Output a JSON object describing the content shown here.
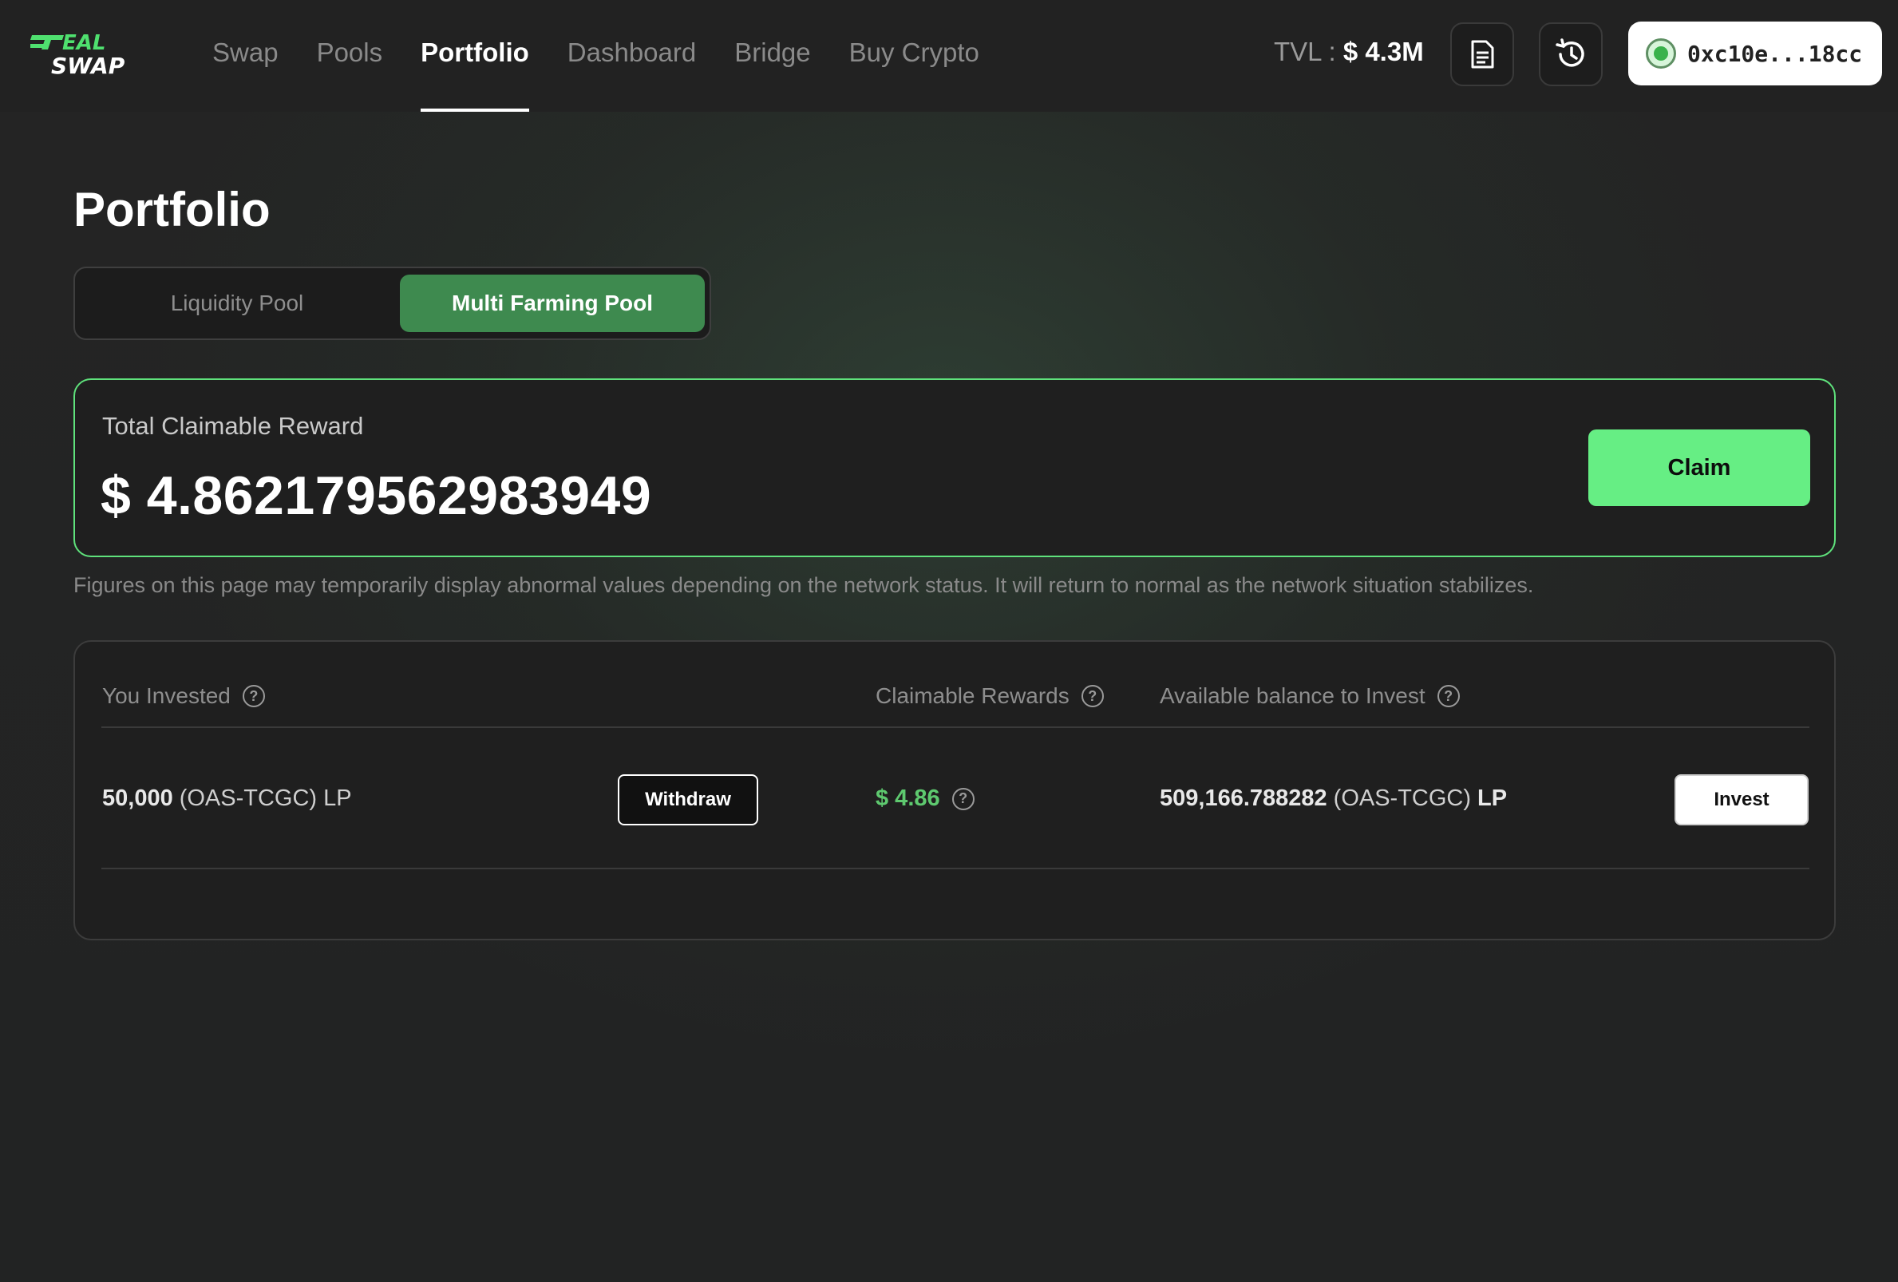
{
  "header": {
    "logo_text": "TEAL SWAP",
    "nav": [
      {
        "label": "Swap"
      },
      {
        "label": "Pools"
      },
      {
        "label": "Portfolio",
        "active": true
      },
      {
        "label": "Dashboard"
      },
      {
        "label": "Bridge"
      },
      {
        "label": "Buy Crypto"
      }
    ],
    "tvl_label": "TVL :",
    "tvl_value": "$ 4.3M",
    "docs_icon": "document-icon",
    "history_icon": "history-icon",
    "wallet_address": "0xc10e...18cc"
  },
  "main": {
    "title": "Portfolio",
    "tabs": [
      {
        "label": "Liquidity Pool",
        "active": false
      },
      {
        "label": "Multi Farming Pool",
        "active": true
      }
    ],
    "reward": {
      "label": "Total Claimable Reward",
      "value": "$ 4.862179562983949",
      "claim_label": "Claim"
    },
    "notice": "Figures on this page may temporarily display abnormal values depending on the network status. It will return to normal as the network situation stabilizes.",
    "table": {
      "headers": {
        "invested": "You Invested",
        "rewards": "Claimable Rewards",
        "available": "Available balance to Invest"
      },
      "row": {
        "invested_amount": "50,000",
        "invested_unit": "(OAS-TCGC) LP",
        "withdraw_label": "Withdraw",
        "reward_value": "$ 4.86",
        "available_amount": "509,166.788282",
        "available_unit": "(OAS-TCGC)",
        "available_suffix": "LP",
        "invest_label": "Invest"
      }
    }
  },
  "colors": {
    "accent_green": "#66ee84",
    "tab_active": "#3e8a4f",
    "reward_text": "#5ec96f"
  }
}
